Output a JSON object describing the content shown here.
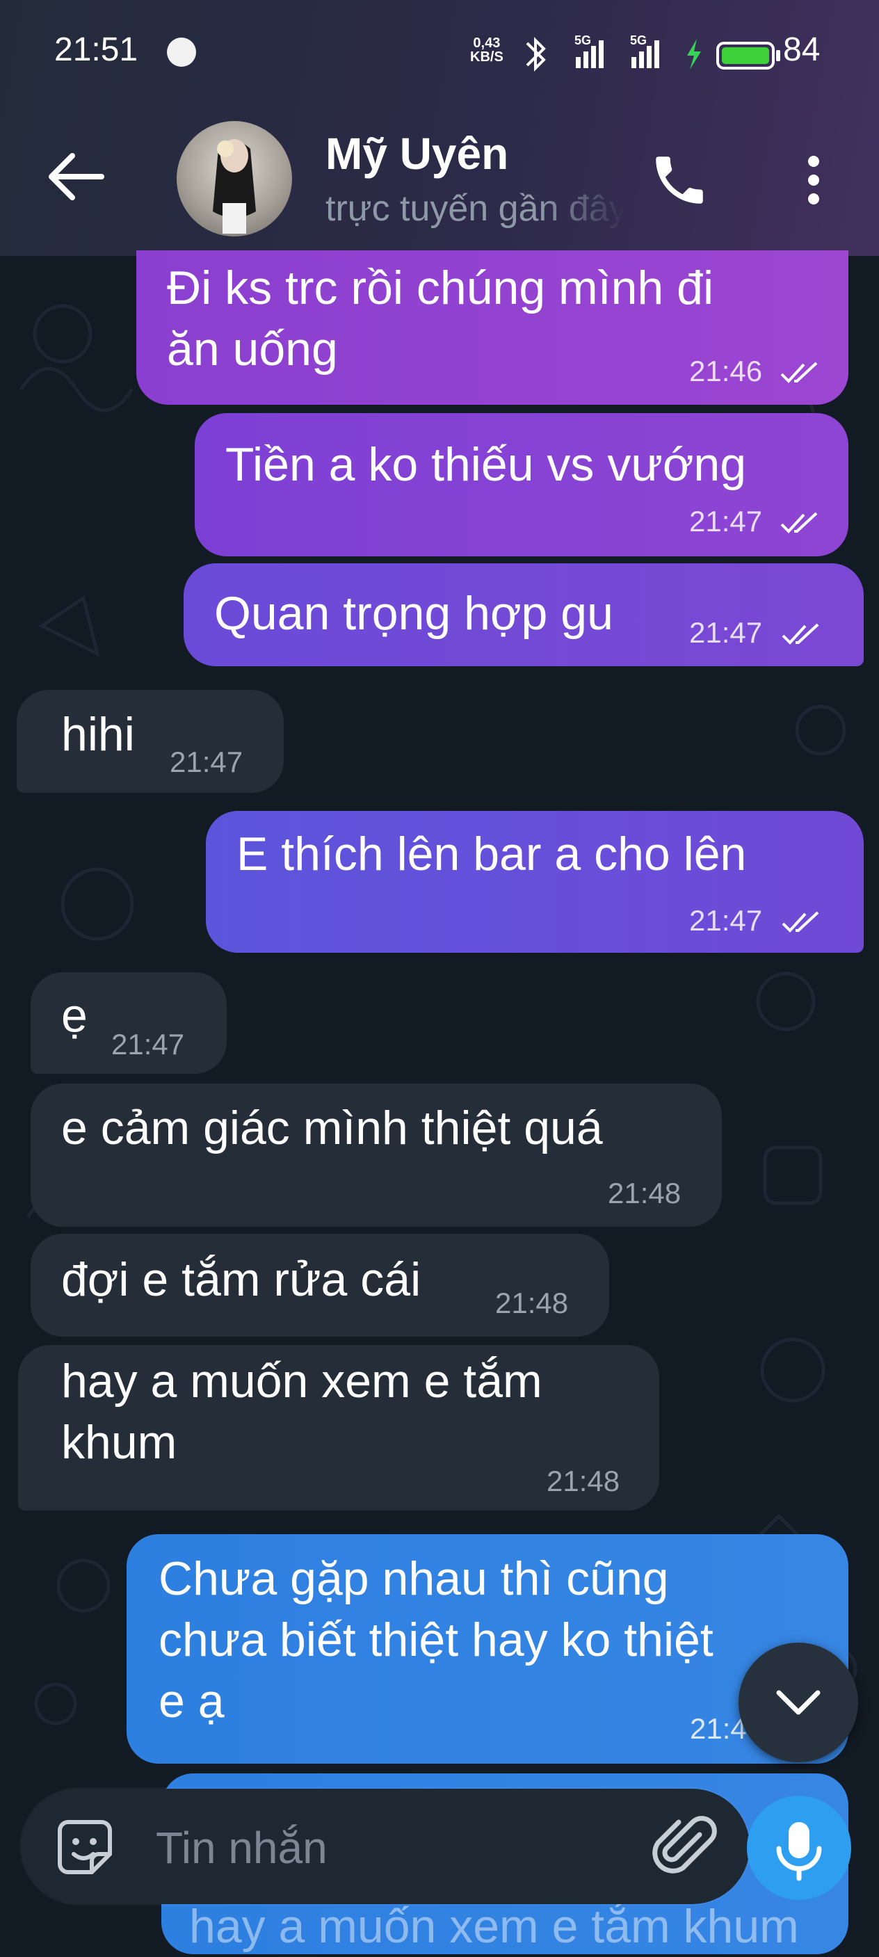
{
  "status_bar": {
    "time": "21:51",
    "speed_value": "0,43",
    "speed_unit": "KB/S",
    "net1": "5G",
    "net2": "5G",
    "battery": "84"
  },
  "header": {
    "name": "Mỹ Uyên",
    "status": "trực tuyến gần đây"
  },
  "messages": [
    {
      "text": "Đi ks trc rồi chúng mình đi\năn uống",
      "time": "21:46"
    },
    {
      "text": "Tiền a ko thiếu vs vướng",
      "time": "21:47"
    },
    {
      "text": "Quan trọng hợp gu",
      "time": "21:47"
    },
    {
      "text": "hihi",
      "time": "21:47"
    },
    {
      "text": "E thích lên bar a cho lên",
      "time": "21:47"
    },
    {
      "text": "ẹ",
      "time": "21:47"
    },
    {
      "text": "e cảm giác mình thiệt quá",
      "time": "21:48"
    },
    {
      "text": "đợi e tắm rửa cái",
      "time": "21:48"
    },
    {
      "text": "hay a muốn xem e tắm\nkhum",
      "time": "21:48"
    },
    {
      "text": "Chưa gặp nhau thì cũng\nchưa biết thiệt hay ko thiệt\ne ạ",
      "time": "21:4"
    },
    {
      "text": "hay a muốn xem e tắm khum"
    }
  ],
  "composer": {
    "placeholder": "Tin nhắn"
  },
  "colors": {
    "background": "#121a24",
    "incoming": "#242d38",
    "outgoing_purple": "#9c46d2",
    "outgoing_blue": "#2d7fe0",
    "mic": "#2e9ef1"
  },
  "icons": [
    "back-arrow-icon",
    "phone-icon",
    "more-vert-icon",
    "sticker-icon",
    "paperclip-icon",
    "microphone-icon",
    "chevron-down-icon",
    "double-check-icon",
    "bluetooth-icon",
    "signal-icon",
    "battery-icon",
    "charging-icon"
  ]
}
